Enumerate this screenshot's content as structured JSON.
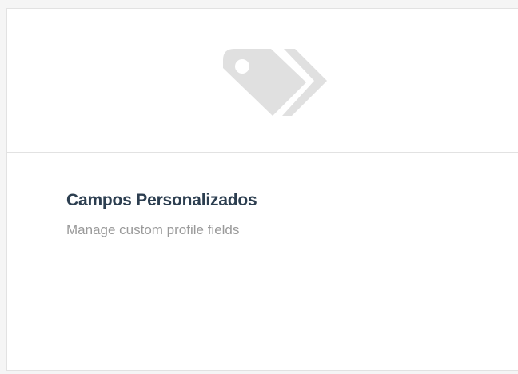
{
  "card": {
    "icon": "tags-icon",
    "title": "Campos Personalizados",
    "description": "Manage custom profile fields"
  },
  "colors": {
    "icon": "#e0e0e0",
    "title": "#2c3e50",
    "description": "#9a9a9a",
    "border": "#e2e2e2"
  }
}
